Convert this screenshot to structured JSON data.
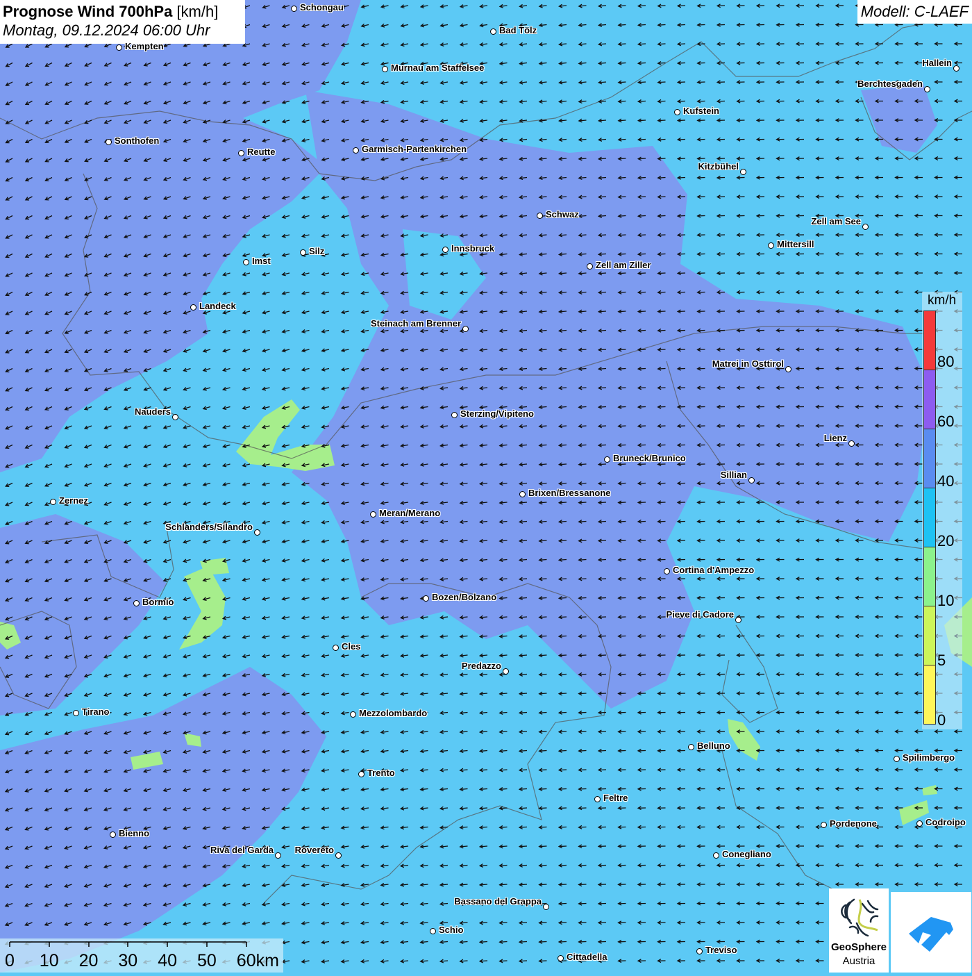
{
  "header": {
    "title_bold": "Prognose Wind 700hPa",
    "title_unit": "[km/h]",
    "subtitle": "Montag, 09.12.2024 06:00 Uhr",
    "model": "Modell: C-LAEF"
  },
  "legend": {
    "unit": "km/h",
    "ticks": [
      "80",
      "60",
      "40",
      "20",
      "10",
      "5",
      "0"
    ],
    "colors": [
      "#f43a3a",
      "#8d5cf0",
      "#5a8cf0",
      "#1ec2f3",
      "#8cf28c",
      "#cdf55a",
      "#fff65a"
    ]
  },
  "map_colors": {
    "wind_20_40": "#5cc9f5",
    "wind_40_60": "#7d9bf0",
    "wind_10_20": "#a6ee8c"
  },
  "wind_direction": "north-east wind (arrows pointing south-west / west)",
  "scale_bar": {
    "labels": [
      "0",
      "10",
      "20",
      "30",
      "40",
      "50",
      "60km"
    ]
  },
  "cities": [
    "Schongau",
    "Bad Tölz",
    "Kempten",
    "Murnau am Staffelsee",
    "Hallein",
    "Berchtesgaden",
    "Kufstein",
    "Sonthofen",
    "Reutte",
    "Garmisch-Partenkirchen",
    "Kitzbühel",
    "Schwaz",
    "Zell am See",
    "Mittersill",
    "Innsbruck",
    "Silz",
    "Imst",
    "Zell am Ziller",
    "Landeck",
    "Steinach am Brenner",
    "Matrei in Osttirol",
    "Nauders",
    "Sterzing/Vipiteno",
    "Lienz",
    "Bruneck/Brunico",
    "Sillian",
    "Brixen/Bressanone",
    "Zernez",
    "Meran/Merano",
    "Schlanders/Silandro",
    "Cortina d'Ampezzo",
    "Bozen/Bolzano",
    "Bormio",
    "Pieve di Cadore",
    "Cles",
    "Predazzo",
    "Tirano",
    "Mezzolombardo",
    "Belluno",
    "Spilimbergo",
    "Trento",
    "Feltre",
    "Pordenone",
    "Codroipo",
    "Bienno",
    "Riva del Garda",
    "Rovereto",
    "Conegliano",
    "Bassano del Grappa",
    "Schio",
    "Treviso",
    "Cittadella"
  ],
  "logos": {
    "geosphere": "GeoSphere",
    "geosphere_sub": "Austria"
  }
}
